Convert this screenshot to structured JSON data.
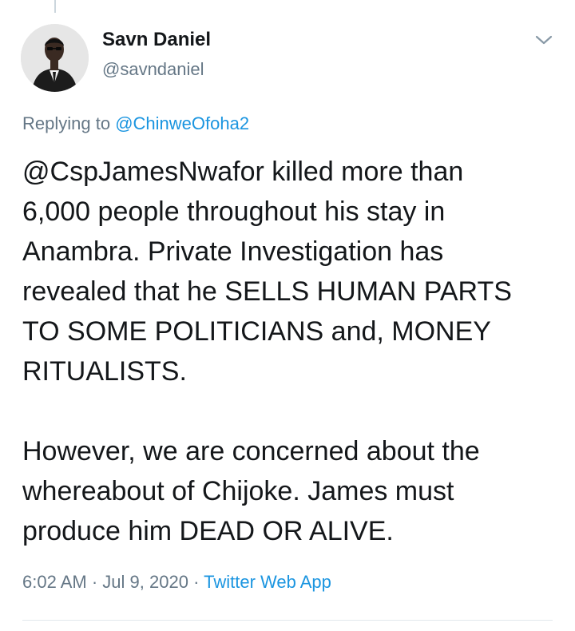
{
  "tweet": {
    "author_name": "Savn Daniel",
    "author_handle": "@savndaniel",
    "replying_prefix": "Replying to",
    "replying_to": "@ChinweOfoha2",
    "paragraph1_line1": "@CspJamesNwafor killed more than",
    "paragraph1_line2": "6,000 people throughout his stay in",
    "paragraph1_line3": "Anambra. Private Investigation has",
    "paragraph1_line4": "revealed that he SELLS HUMAN PARTS",
    "paragraph1_line5": "TO SOME POLITICIANS and, MONEY",
    "paragraph1_line6": "RITUALISTS.",
    "paragraph2_line1": "However, we are concerned about the",
    "paragraph2_line2": "whereabout of Chijoke. James must",
    "paragraph2_line3": "produce him DEAD OR ALIVE.",
    "time": "6:02 AM",
    "separator": "·",
    "date": "Jul 9, 2020",
    "source": "Twitter Web App"
  },
  "icons": {
    "menu": "chevron-down-icon",
    "avatar": "profile-photo"
  },
  "colors": {
    "primary_text": "#14171a",
    "secondary_text": "#657786",
    "link": "#1b95e0",
    "divider": "#e1e8ed"
  }
}
